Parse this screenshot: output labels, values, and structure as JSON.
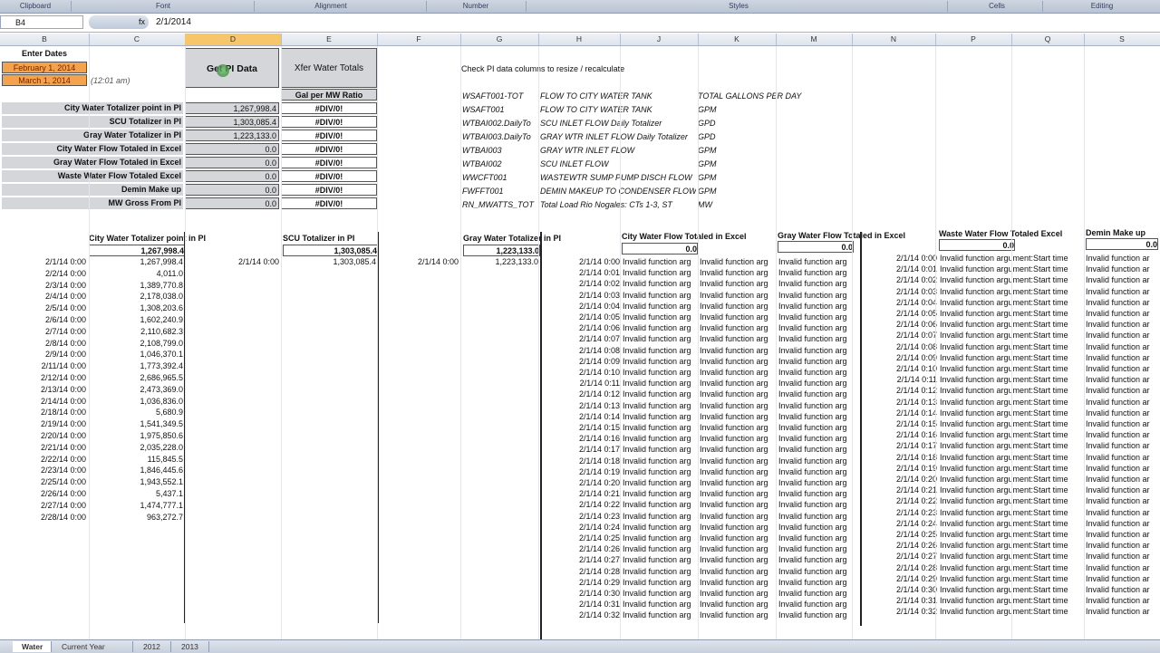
{
  "ribbon": {
    "groups": [
      "Clipboard",
      "Font",
      "Alignment",
      "Number",
      "Styles",
      "Cells",
      "Editing"
    ]
  },
  "formula_bar": {
    "name_box": "B4",
    "fx": "fx",
    "value": "2/1/2014"
  },
  "columns": [
    "B",
    "C",
    "D",
    "E",
    "F",
    "G",
    "H",
    "J",
    "K",
    "M",
    "N",
    "P",
    "Q",
    "S"
  ],
  "top": {
    "enter_dates": "Enter Dates",
    "date_start": "February 1, 2014",
    "date_end": "March 1, 2014",
    "time_note": "(12:01 am)",
    "get_data_btn": "Get PI Data",
    "xfer_btn": "Xfer Water Totals",
    "check_note": "Check PI data columns to resize / recalculate",
    "ratio_header": "Gal per MW Ratio"
  },
  "summary": [
    {
      "label": "City Water Totalizer point in PI",
      "value": "1,267,998.4",
      "ratio": "#DIV/0!"
    },
    {
      "label": "SCU Totalizer in PI",
      "value": "1,303,085.4",
      "ratio": "#DIV/0!"
    },
    {
      "label": "Gray Water Totalizer in PI",
      "value": "1,223,133.0",
      "ratio": "#DIV/0!"
    },
    {
      "label": "City Water Flow Totaled in Excel",
      "value": "0.0",
      "ratio": "#DIV/0!"
    },
    {
      "label": "Gray Water Flow Totaled in Excel",
      "value": "0.0",
      "ratio": "#DIV/0!"
    },
    {
      "label": "Waste Water Flow Totaled Excel",
      "value": "0.0",
      "ratio": "#DIV/0!"
    },
    {
      "label": "Demin Make up",
      "value": "0.0",
      "ratio": "#DIV/0!"
    },
    {
      "label": "MW Gross From PI",
      "value": "0.0",
      "ratio": "#DIV/0!"
    }
  ],
  "tags": [
    {
      "tag": "WSAFT001-TOT",
      "desc": "FLOW TO CITY WATER TANK",
      "unit": "TOTAL GALLONS PER DAY"
    },
    {
      "tag": "WSAFT001",
      "desc": "FLOW TO CITY WATER TANK",
      "unit": "GPM"
    },
    {
      "tag": "WTBAI002.DailyTo",
      "desc": "SCU INLET FLOW Daily Totalizer",
      "unit": "GPD"
    },
    {
      "tag": "WTBAI003.DailyTo",
      "desc": "GRAY WTR INLET FLOW Daily Totalizer",
      "unit": "GPD"
    },
    {
      "tag": "WTBAI003",
      "desc": "GRAY WTR INLET FLOW",
      "unit": "GPM"
    },
    {
      "tag": "WTBAI002",
      "desc": "SCU INLET FLOW",
      "unit": "GPM"
    },
    {
      "tag": "WWCFT001",
      "desc": "WASTEWTR SUMP PUMP DISCH FLOW",
      "unit": "GPM"
    },
    {
      "tag": "FWFFT001",
      "desc": "DEMIN MAKEUP TO CONDENSER FLOW",
      "unit": "GPM"
    },
    {
      "tag": "RN_MWATTS_TOT",
      "desc": "Total Load Rio Nogales: CTs 1-3, ST",
      "unit": "MW"
    }
  ],
  "sections": {
    "city_total_hdr": "City Water Totalizer point in PI",
    "city_total_val": "1,267,998.4",
    "scu_hdr": "SCU Totalizer in PI",
    "scu_val": "1,303,085.4",
    "scu_date": "2/1/14 0:00",
    "scu_first": "1,303,085.4",
    "gray_hdr": "Gray Water  Totalizer in PI",
    "gray_val": "1,223,133.0",
    "gray_date": "2/1/14 0:00",
    "gray_first": "1,223,133.0",
    "city_flow_hdr": "City Water Flow Totaled in Excel",
    "city_flow_val": "0.0",
    "gray_flow_hdr": "Gray Water Flow Totaled in Excel",
    "gray_flow_val": "0.0",
    "waste_hdr": "Waste Water Flow Totaled Excel",
    "waste_val": "0.0",
    "demin_hdr": "Demin Make up",
    "demin_val": "0.0"
  },
  "daily": [
    [
      "2/1/14 0:00",
      "1,267,998.4"
    ],
    [
      "2/2/14 0:00",
      "4,011.0"
    ],
    [
      "2/3/14 0:00",
      "1,389,770.8"
    ],
    [
      "2/4/14 0:00",
      "2,178,038.0"
    ],
    [
      "2/5/14 0:00",
      "1,308,203.6"
    ],
    [
      "2/6/14 0:00",
      "1,602,240.9"
    ],
    [
      "2/7/14 0:00",
      "2,110,682.3"
    ],
    [
      "2/8/14 0:00",
      "2,108,799.0"
    ],
    [
      "2/9/14 0:00",
      "1,046,370.1"
    ],
    [
      "2/11/14 0:00",
      "1,773,392.4"
    ],
    [
      "2/12/14 0:00",
      "2,686,965.5"
    ],
    [
      "2/13/14 0:00",
      "2,473,369.0"
    ],
    [
      "2/14/14 0:00",
      "1,036,836.0"
    ],
    [
      "2/18/14 0:00",
      "5,680.9"
    ],
    [
      "2/19/14 0:00",
      "1,541,349.5"
    ],
    [
      "2/20/14 0:00",
      "1,975,850.6"
    ],
    [
      "2/21/14 0:00",
      "2,035,228.0"
    ],
    [
      "2/22/14 0:00",
      "115,845.5"
    ],
    [
      "2/23/14 0:00",
      "1,846,445.6"
    ],
    [
      "2/25/14 0:00",
      "1,943,552.1"
    ],
    [
      "2/26/14 0:00",
      "5,437.1"
    ],
    [
      "2/27/14 0:00",
      "1,474,777.1"
    ],
    [
      "2/28/14 0:00",
      "963,272.7"
    ]
  ],
  "minutes": [
    "2/1/14 0:00",
    "2/1/14 0:01",
    "2/1/14 0:02",
    "2/1/14 0:03",
    "2/1/14 0:04",
    "2/1/14 0:05",
    "2/1/14 0:06",
    "2/1/14 0:07",
    "2/1/14 0:08",
    "2/1/14 0:09",
    "2/1/14 0:10",
    "2/1/14 0:11",
    "2/1/14 0:12",
    "2/1/14 0:13",
    "2/1/14 0:14",
    "2/1/14 0:15",
    "2/1/14 0:16",
    "2/1/14 0:17",
    "2/1/14 0:18",
    "2/1/14 0:19",
    "2/1/14 0:20",
    "2/1/14 0:21",
    "2/1/14 0:22",
    "2/1/14 0:23",
    "2/1/14 0:24",
    "2/1/14 0:25",
    "2/1/14 0:26",
    "2/1/14 0:27",
    "2/1/14 0:28",
    "2/1/14 0:29",
    "2/1/14 0:30",
    "2/1/14 0:31",
    "2/1/14 0:32"
  ],
  "invalid_short": "Invalid function arg",
  "invalid_long": "Invalid function argument:Start time",
  "invalid_tail": "Invalid function ar",
  "sheet_tabs": [
    "Water",
    "Current Year",
    "2012",
    "2013"
  ]
}
